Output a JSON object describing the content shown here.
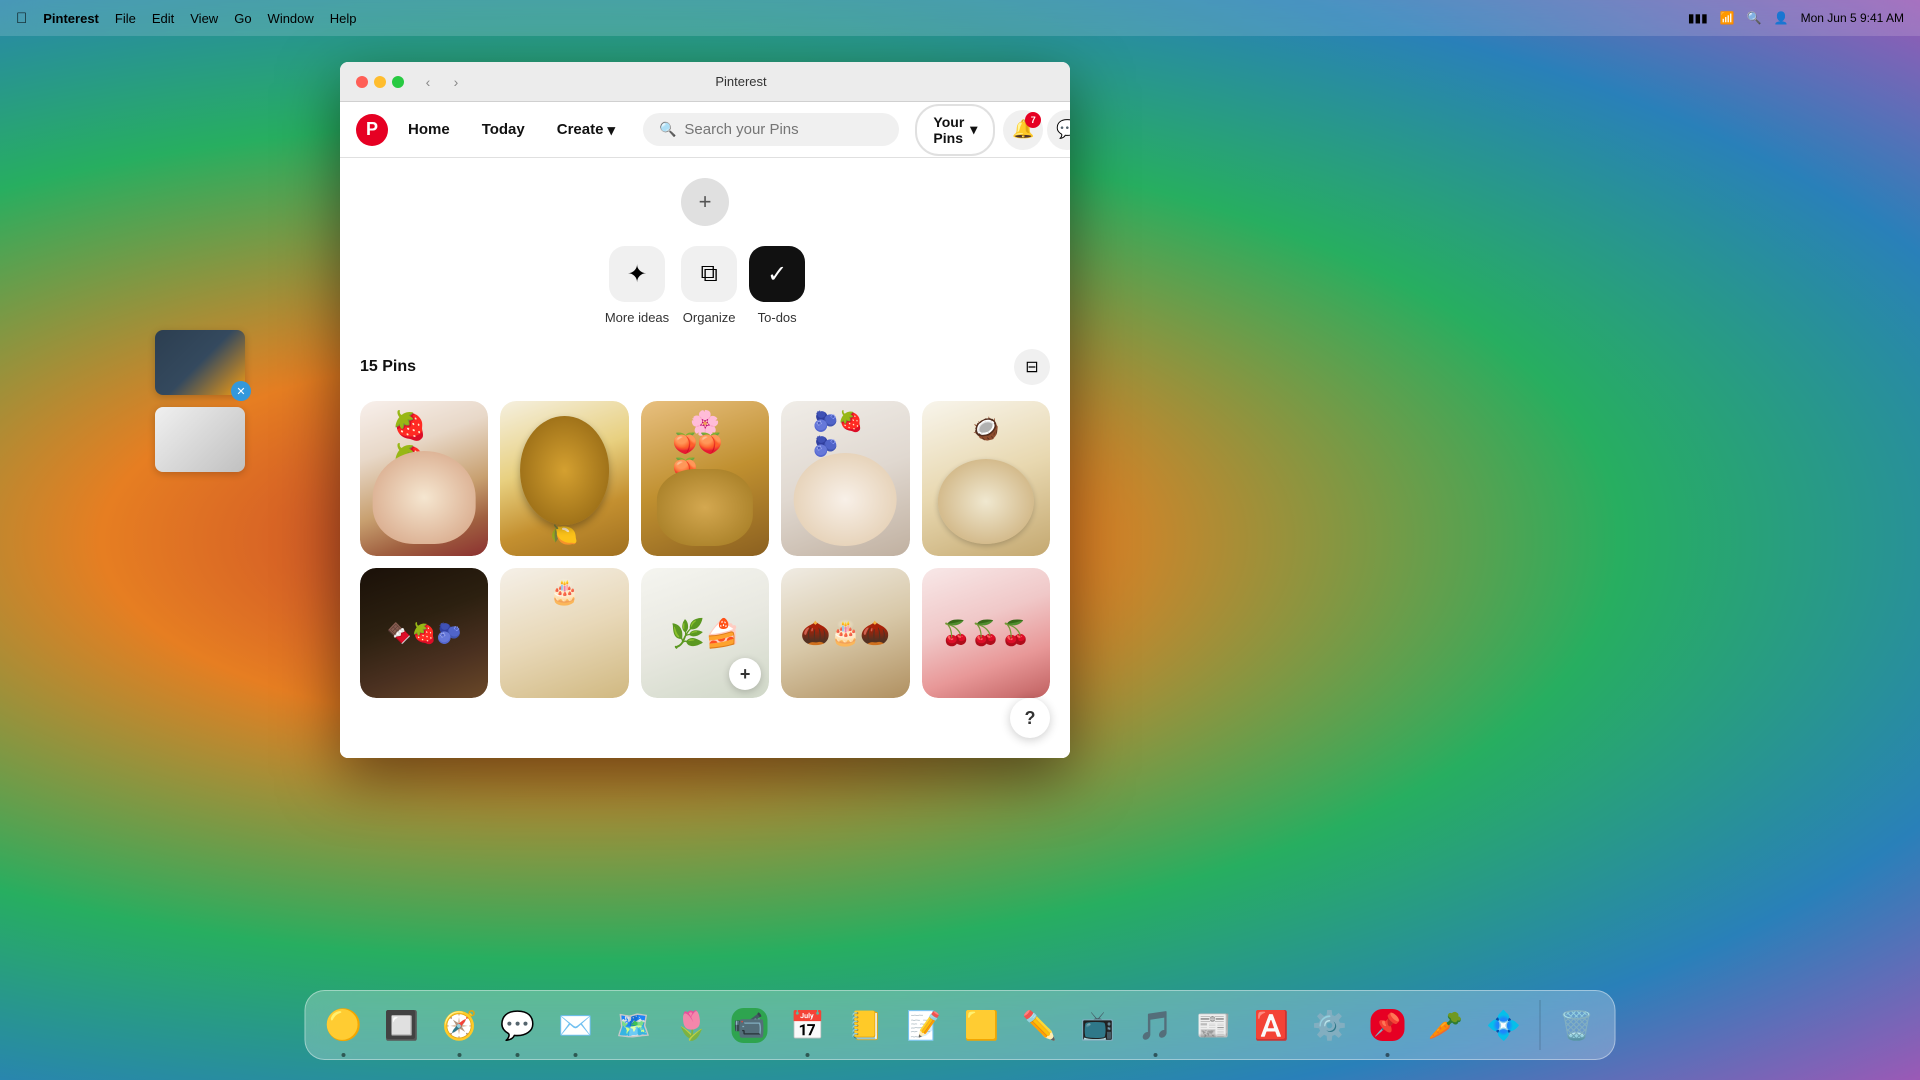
{
  "mac": {
    "menubar": {
      "app": "Pinterest",
      "menus": [
        "File",
        "Edit",
        "View",
        "Go",
        "Window",
        "Help"
      ],
      "time": "Mon Jun 5  9:41 AM"
    },
    "window_title": "Pinterest"
  },
  "nav": {
    "logo": "P",
    "home_label": "Home",
    "today_label": "Today",
    "create_label": "Create",
    "search_placeholder": "Search your Pins",
    "your_pins_label": "Your Pins",
    "notification_count": "7",
    "chevron": "▾"
  },
  "add_button": "+",
  "actions": [
    {
      "id": "more-ideas",
      "label": "More ideas",
      "icon": "✦"
    },
    {
      "id": "organize",
      "label": "Organize",
      "icon": "⧉"
    },
    {
      "id": "todos",
      "label": "To-dos",
      "icon": "✓",
      "active": true
    }
  ],
  "pins_section": {
    "count_label": "15 Pins",
    "filter_icon": "⊟"
  },
  "pins_row1": [
    {
      "id": "pin-1",
      "color_main": "#c0392b",
      "color_accent": "#8B0000"
    },
    {
      "id": "pin-2",
      "color_main": "#cd853f",
      "color_accent": "#8B7355"
    },
    {
      "id": "pin-3",
      "color_main": "#d4a017",
      "color_accent": "#8B6914"
    },
    {
      "id": "pin-4",
      "color_main": "#e8e0d8",
      "color_accent": "#1a1a2e"
    },
    {
      "id": "pin-5",
      "color_main": "#e8d5a0",
      "color_accent": "#c4a44a"
    }
  ],
  "pins_row2": [
    {
      "id": "pin-6",
      "color_main": "#2c1810",
      "color_accent": "#8B4513"
    },
    {
      "id": "pin-7",
      "color_main": "#d4c09a",
      "color_accent": "#8B7355"
    },
    {
      "id": "pin-8",
      "color_main": "#e8f5e8",
      "color_accent": "#2d5a27",
      "has_add": true
    },
    {
      "id": "pin-9",
      "color_main": "#d4c09a",
      "color_accent": "#6B4226"
    },
    {
      "id": "pin-10",
      "color_main": "#dc143c",
      "color_accent": "#8B0000"
    }
  ],
  "dock": {
    "apps": [
      {
        "id": "finder",
        "icon": "🔵",
        "label": "Finder",
        "has_dot": true
      },
      {
        "id": "launchpad",
        "icon": "🔲",
        "label": "Launchpad",
        "has_dot": false
      },
      {
        "id": "safari",
        "icon": "🧭",
        "label": "Safari",
        "has_dot": true
      },
      {
        "id": "messages",
        "icon": "💬",
        "label": "Messages",
        "has_dot": true
      },
      {
        "id": "mail",
        "icon": "✉️",
        "label": "Mail",
        "has_dot": true
      },
      {
        "id": "maps",
        "icon": "🗺️",
        "label": "Maps",
        "has_dot": false
      },
      {
        "id": "photos",
        "icon": "🌸",
        "label": "Photos",
        "has_dot": false
      },
      {
        "id": "facetime",
        "icon": "📹",
        "label": "FaceTime",
        "has_dot": false
      },
      {
        "id": "calendar",
        "icon": "📅",
        "label": "Calendar",
        "has_dot": false
      },
      {
        "id": "contacts",
        "icon": "📒",
        "label": "Contacts",
        "has_dot": false
      },
      {
        "id": "reminders",
        "icon": "📝",
        "label": "Reminders",
        "has_dot": false
      },
      {
        "id": "notes",
        "icon": "🟡",
        "label": "Notes",
        "has_dot": false
      },
      {
        "id": "freeform",
        "icon": "✏️",
        "label": "Freeform",
        "has_dot": false
      },
      {
        "id": "appletv",
        "icon": "📺",
        "label": "Apple TV",
        "has_dot": false
      },
      {
        "id": "music",
        "icon": "🎵",
        "label": "Music",
        "has_dot": false
      },
      {
        "id": "news",
        "icon": "📰",
        "label": "News",
        "has_dot": false
      },
      {
        "id": "appstore",
        "icon": "🅰️",
        "label": "App Store",
        "has_dot": false
      },
      {
        "id": "systemprefs",
        "icon": "⚙️",
        "label": "System Settings",
        "has_dot": false
      },
      {
        "id": "pinterest",
        "icon": "📌",
        "label": "Pinterest",
        "has_dot": true
      },
      {
        "id": "carrot",
        "icon": "🥕",
        "label": "Carrot Weather",
        "has_dot": false
      },
      {
        "id": "pricetag",
        "icon": "💠",
        "label": "Pricetag",
        "has_dot": false
      },
      {
        "id": "trash",
        "icon": "🗑️",
        "label": "Trash",
        "has_dot": false
      }
    ]
  },
  "help_button_label": "?",
  "add_pin_label": "+"
}
